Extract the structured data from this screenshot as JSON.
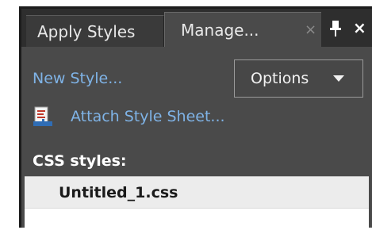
{
  "tabs": {
    "apply_styles": "Apply Styles",
    "manage_styles": "Manage...",
    "close_glyph": "×"
  },
  "window": {
    "close_glyph": "×"
  },
  "actions": {
    "new_style": "New Style...",
    "options": "Options",
    "attach_style_sheet": "Attach Style Sheet..."
  },
  "css_styles": {
    "heading": "CSS styles:",
    "items": [
      "Untitled_1.css"
    ]
  },
  "icons": {
    "pin": "pin-icon",
    "panel_close": "close-icon",
    "attach": "attach-stylesheet-icon",
    "options_caret": "caret-down-icon"
  },
  "colors": {
    "panel_bg": "#4a4a4a",
    "link": "#7fb3e6",
    "text": "#e8e8e8"
  }
}
